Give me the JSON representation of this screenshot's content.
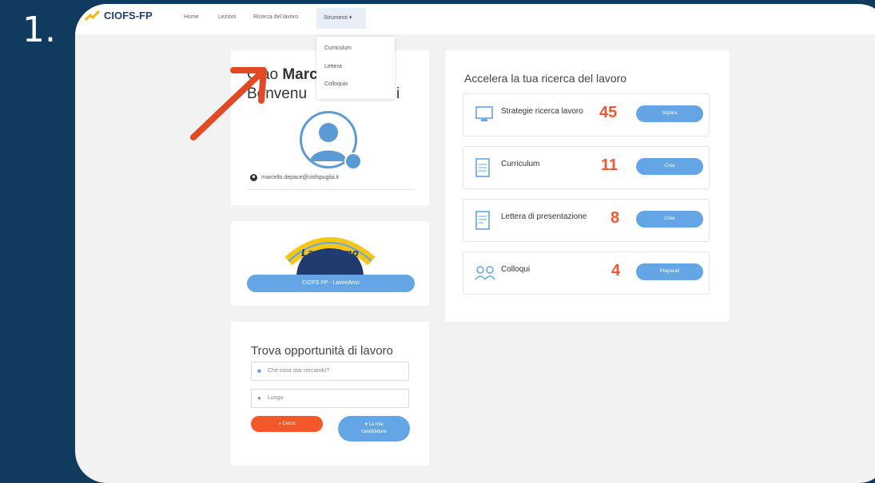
{
  "step": {
    "number": "1."
  },
  "nav": {
    "brand": "CIOFS-FP",
    "links": [
      "Home",
      "Lezioni",
      "Ricerca del lavoro"
    ],
    "strumenti": "Strumenti ▾",
    "dropdown": [
      "Curriculum",
      "Lettera",
      "Colloquio"
    ]
  },
  "profile": {
    "greeting_prefix": "Ciao ",
    "name_bold": "Marc",
    "name_tail": "e,",
    "welcome_start": "Benvenu",
    "welcome_end": "i",
    "email": "marcello.depace@ciofspuglia.it"
  },
  "lavoriamo": {
    "logo_text": "LavoriAmo",
    "button": "CIOFS FP - LavoriAmo"
  },
  "jobs": {
    "title": "Trova opportunità di lavoro",
    "what_placeholder": "Che cosa stai cercando?",
    "where_placeholder": "Luogo",
    "search_button": "Cerca",
    "applications_button_line1": "La mia",
    "applications_button_line2": "candidature"
  },
  "accelerate": {
    "title": "Accelera la tua ricerca del lavoro",
    "tools": [
      {
        "label": "Strategie ricerca lavoro",
        "count": "45",
        "button": "Impara",
        "icon": "monitor-icon"
      },
      {
        "label": "Curriculum",
        "count": "11",
        "button": "Crea",
        "icon": "document-icon"
      },
      {
        "label": "Lettera di presentazione",
        "count": "8",
        "button": "Crea",
        "icon": "letter-icon"
      },
      {
        "label": "Colloqui",
        "count": "4",
        "button": "Preparati",
        "icon": "interview-icon"
      }
    ]
  },
  "colors": {
    "background": "#103b5e",
    "accent_blue": "#64a5e6",
    "accent_orange": "#f2582b",
    "arrow": "#e24a25"
  }
}
